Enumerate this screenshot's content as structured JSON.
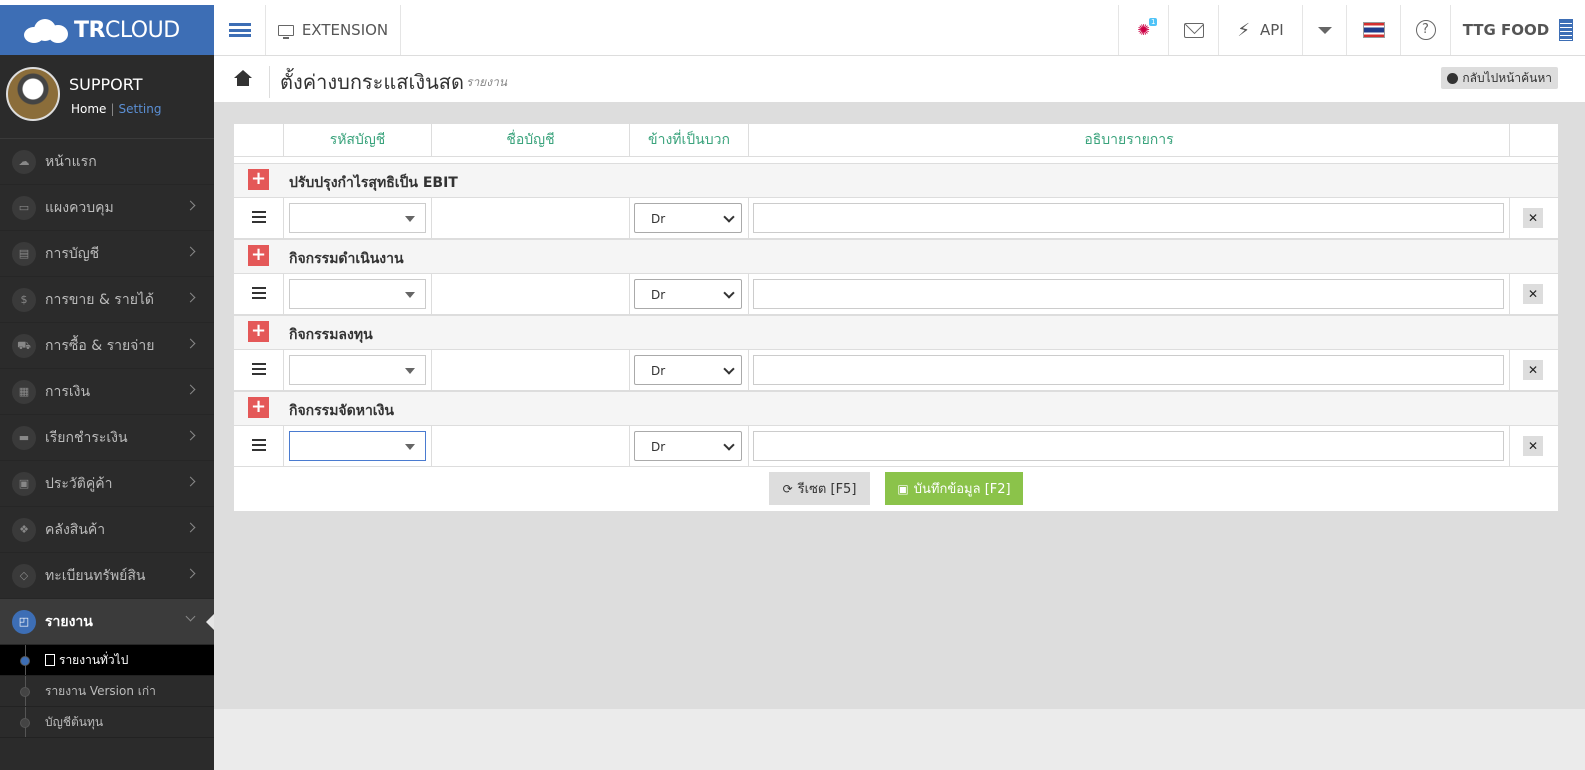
{
  "brand": {
    "tr": "TR",
    "cloud": "CLOUD"
  },
  "topbar": {
    "extension": "EXTENSION",
    "notify_badge": "1",
    "api": "API",
    "user": "TTG FOOD"
  },
  "profile": {
    "name": "SUPPORT",
    "home": "Home",
    "setting": "Setting"
  },
  "sidebar": {
    "items": [
      {
        "label": "หน้าแรก",
        "icon": "cloud-icon"
      },
      {
        "label": "แผงควบคุม",
        "icon": "monitor-icon"
      },
      {
        "label": "การบัญชี",
        "icon": "book-icon"
      },
      {
        "label": "การขาย & รายได้",
        "icon": "dollar-icon"
      },
      {
        "label": "การซื้อ & รายจ่าย",
        "icon": "cart-icon"
      },
      {
        "label": "การเงิน",
        "icon": "calendar-icon"
      },
      {
        "label": "เรียกชำระเงิน",
        "icon": "card-icon"
      },
      {
        "label": "ประวัติคู่ค้า",
        "icon": "contact-icon"
      },
      {
        "label": "คลังสินค้า",
        "icon": "cubes-icon"
      },
      {
        "label": "ทะเบียนทรัพย์สิน",
        "icon": "diamond-icon"
      },
      {
        "label": "รายงาน",
        "icon": "report-icon"
      }
    ],
    "sub_items": [
      {
        "label": "รายงานทั่วไป"
      },
      {
        "label": "รายงาน Version เก่า"
      },
      {
        "label": "บัญชีต้นทุน"
      }
    ]
  },
  "page": {
    "title": "ตั้งค่างบกระแสเงินสด",
    "subtitle": "รายงาน",
    "back": "กลับไปหน้าค้นหา"
  },
  "table": {
    "headers": [
      "รหัสบัญชี",
      "ชื่อบัญชี",
      "ข้างที่เป็นบวก",
      "อธิบายรายการ"
    ],
    "groups": [
      {
        "label": "ปรับปรุงกำไรสุทธิเป็น EBIT",
        "side": "Dr"
      },
      {
        "label": "กิจกรรมดำเนินงาน",
        "side": "Dr"
      },
      {
        "label": "กิจกรรมลงทุน",
        "side": "Dr"
      },
      {
        "label": "กิจกรรมจัดหาเงิน",
        "side": "Dr"
      }
    ]
  },
  "buttons": {
    "reset": "รีเซต [F5]",
    "save": "บันทึกข้อมูล [F2]"
  },
  "colors": {
    "brand": "#3d6eb5",
    "header_text": "#3aa37c",
    "plus": "#e45858",
    "save": "#8bc34a"
  }
}
